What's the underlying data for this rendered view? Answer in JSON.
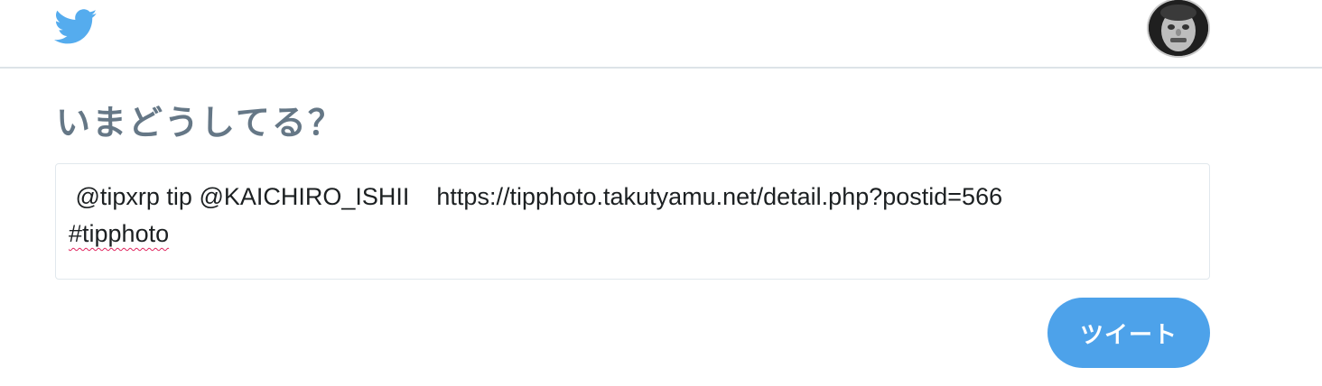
{
  "header": {
    "logo_icon": "twitter-bird-icon",
    "avatar_icon": "user-avatar",
    "brand_color": "#55acee"
  },
  "compose": {
    "heading": "いまどうしてる？",
    "text_line1": " @tipxrp tip @KAICHIRO_ISHII    https://tipphoto.takutyamu.net/detail.php?postid=566",
    "text_hashtag": "#tipphoto",
    "submit_label": "ツイート",
    "submit_color": "#4da2ea"
  }
}
